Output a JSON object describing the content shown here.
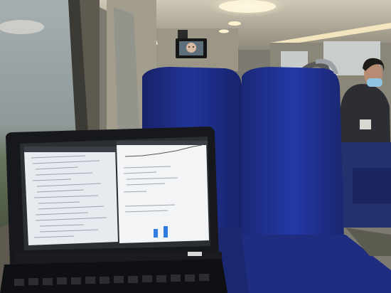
{
  "scene": {
    "colors": {
      "ceiling": "#b9b3a3",
      "wall": "#8f8b80",
      "seat_blue": "#1f2f8a",
      "seat_dark": "#15205e",
      "window_sky": "#9ea8ab",
      "field_green": "#5f6e52",
      "laptop_body": "#1d1f24",
      "screen_left": "#e9ecf0",
      "screen_right": "#f2f4f6",
      "bar_blue": "#2f7de0"
    },
    "objects": [
      "train-window-left",
      "ceiling-lights",
      "overhead-tv-screen",
      "blue-seat-left",
      "blue-seat-right",
      "passenger-with-mask",
      "laptop-with-code-editor"
    ]
  }
}
